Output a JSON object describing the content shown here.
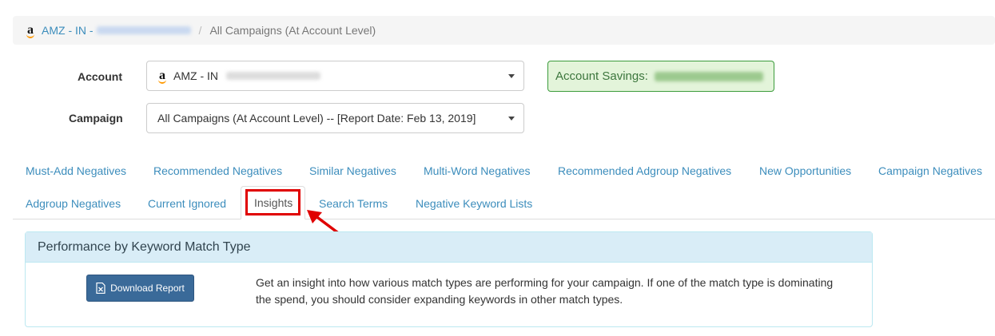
{
  "breadcrumb": {
    "account_link": "AMZ - IN -",
    "separator": "/",
    "current": "All Campaigns (At Account Level)"
  },
  "form": {
    "account_label": "Account",
    "account_value": "AMZ - IN",
    "campaign_label": "Campaign",
    "campaign_value": "All Campaigns (At Account Level) -- [Report Date: Feb 13, 2019]"
  },
  "savings": {
    "label": "Account Savings:"
  },
  "tabs": [
    {
      "label": "Must-Add Negatives"
    },
    {
      "label": "Recommended Negatives"
    },
    {
      "label": "Similar Negatives"
    },
    {
      "label": "Multi-Word Negatives"
    },
    {
      "label": "Recommended Adgroup Negatives"
    },
    {
      "label": "New Opportunities"
    },
    {
      "label": "Campaign Negatives"
    },
    {
      "label": "Adgroup Negatives"
    },
    {
      "label": "Current Ignored"
    },
    {
      "label": "Insights",
      "active": true
    },
    {
      "label": "Search Terms"
    },
    {
      "label": "Negative Keyword Lists"
    }
  ],
  "panel": {
    "title": "Performance by Keyword Match Type",
    "download_label": "Download Report",
    "description": "Get an insight into how various match types are performing for your campaign. If one of the match type is dominating the spend, you should consider expanding keywords in other match types."
  },
  "colors": {
    "link": "#3c8dbc",
    "highlight": "#e00000",
    "panel_heading": "#d9edf7",
    "savings_bg": "#e3f4da",
    "button": "#3a6a99"
  },
  "icons": [
    "amazon-logo-icon",
    "caret-down-icon",
    "file-excel-icon",
    "red-arrow-annotation"
  ]
}
